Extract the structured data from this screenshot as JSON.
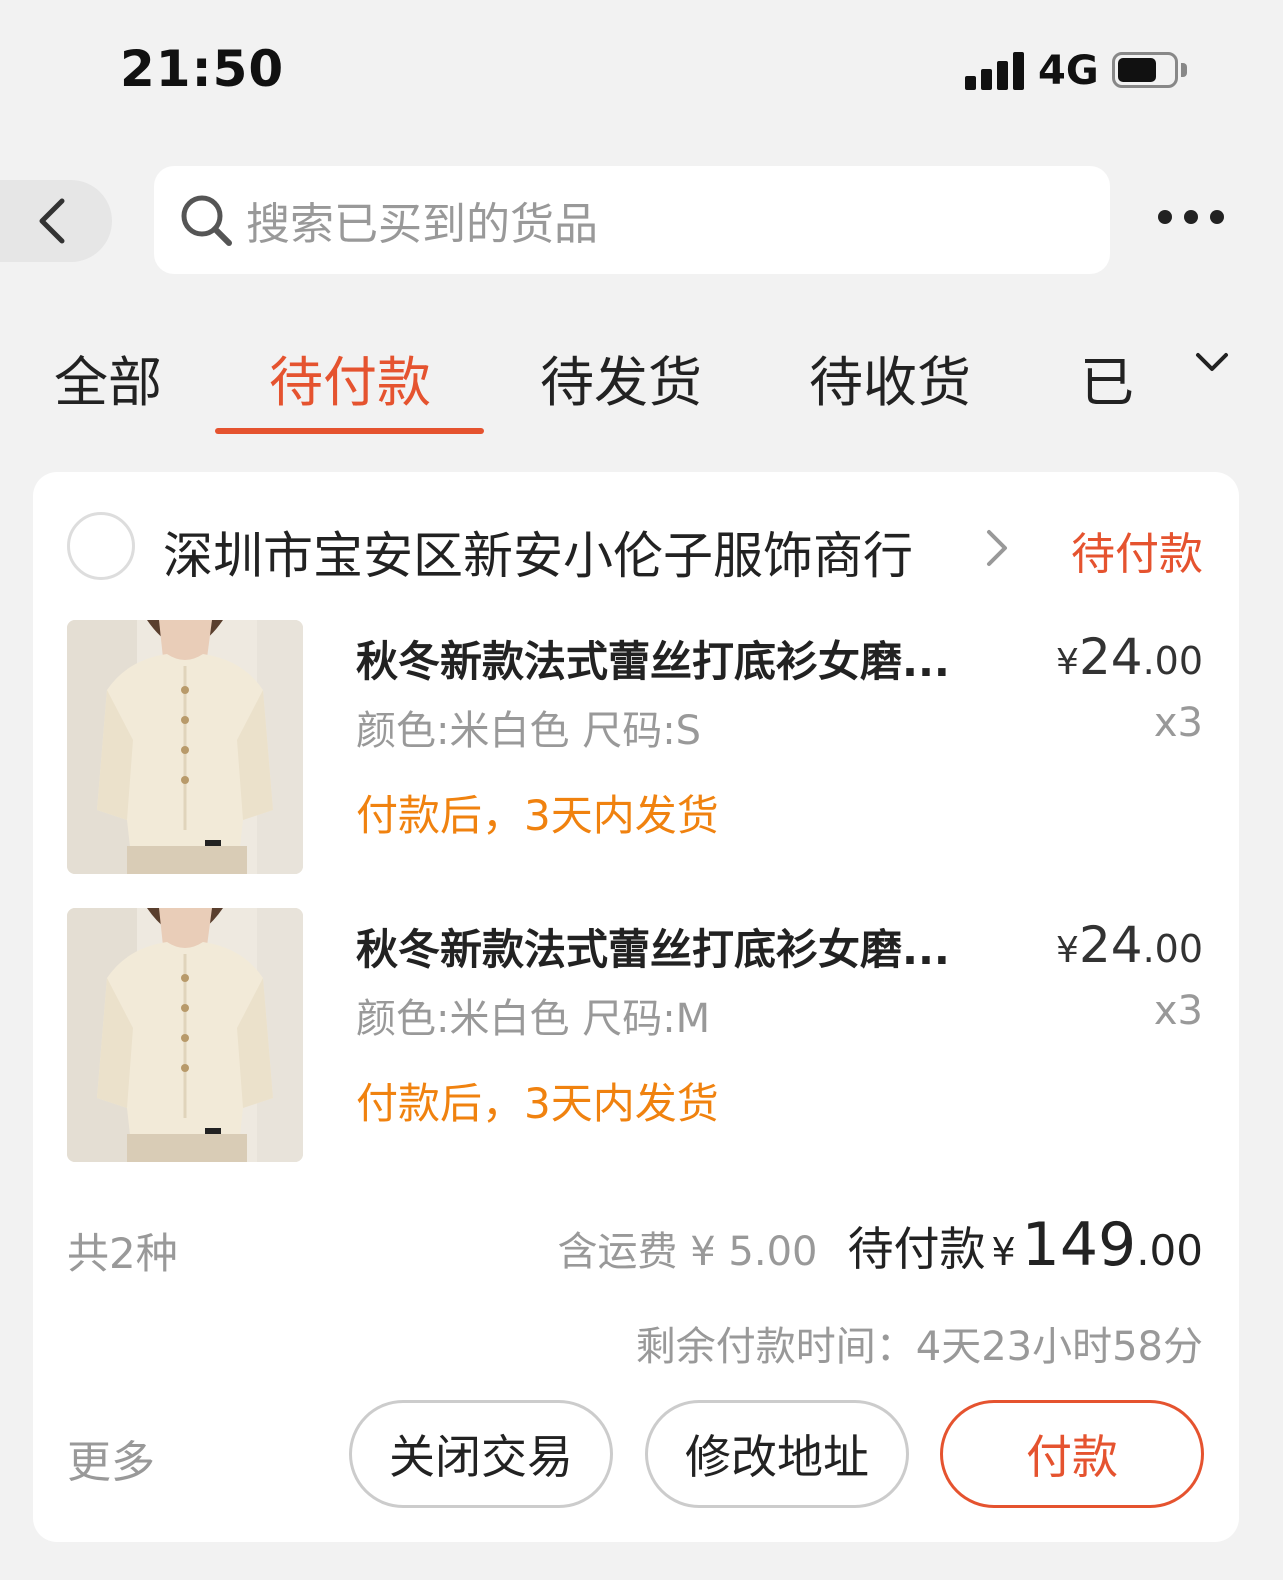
{
  "status_bar": {
    "time": "21:50",
    "network": "4G",
    "icons": [
      "signal-icon",
      "battery-icon"
    ]
  },
  "header": {
    "search_placeholder": "搜索已买到的货品",
    "icons": [
      "back-arrow-icon",
      "search-icon",
      "more-dots-icon"
    ]
  },
  "tabs": [
    {
      "label": "全部",
      "active": false
    },
    {
      "label": "待付款",
      "active": true
    },
    {
      "label": "待发货",
      "active": false
    },
    {
      "label": "待收货",
      "active": false
    },
    {
      "label": "已",
      "active": false
    }
  ],
  "order": {
    "shop_name": "深圳市宝安区新安小伦子服饰商行",
    "status": "待付款",
    "items": [
      {
        "title": "秋冬新款法式蕾丝打底衫女磨...",
        "sku": "颜色:米白色 尺码:S",
        "shipping_note": "付款后，3天内发货",
        "price_currency": "¥",
        "price_int": "24",
        "price_dec": ".00",
        "quantity": "x3"
      },
      {
        "title": "秋冬新款法式蕾丝打底衫女磨...",
        "sku": "颜色:米白色 尺码:M",
        "shipping_note": "付款后，3天内发货",
        "price_currency": "¥",
        "price_int": "24",
        "price_dec": ".00",
        "quantity": "x3"
      }
    ],
    "kinds_count": "共2种",
    "shipping_fee": "含运费 ¥ 5.00",
    "due_label": "待付款",
    "total_currency": "¥",
    "total_int": "149",
    "total_dec": ".00",
    "remaining_time": "剩余付款时间：4天23小时58分",
    "more_label": "更多",
    "buttons": {
      "close": "关闭交易",
      "edit_address": "修改地址",
      "pay": "付款"
    }
  },
  "colors": {
    "accent": "#e5532f",
    "shipping_note": "#f0820f",
    "background": "#f2f2f2"
  }
}
